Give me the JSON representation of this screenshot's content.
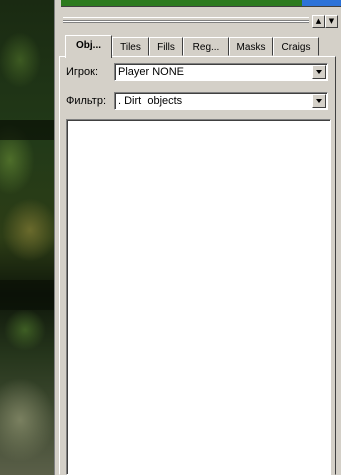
{
  "tabs": [
    {
      "label": "Obj..."
    },
    {
      "label": "Tiles"
    },
    {
      "label": "Fills"
    },
    {
      "label": "Reg..."
    },
    {
      "label": "Masks"
    },
    {
      "label": "Craigs"
    }
  ],
  "player": {
    "label": "Игрок:",
    "value": "Player NONE"
  },
  "filter": {
    "label": "Фильтр:",
    "value": ". Dirt  objects"
  },
  "window_buttons": {
    "up": "▲",
    "down": "▼"
  },
  "icons": {
    "dropdown": "chevron-down-icon"
  },
  "colors": {
    "panel": "#d4d0c8",
    "progress_green": "#2c7a1e",
    "progress_blue": "#2c72d8"
  }
}
